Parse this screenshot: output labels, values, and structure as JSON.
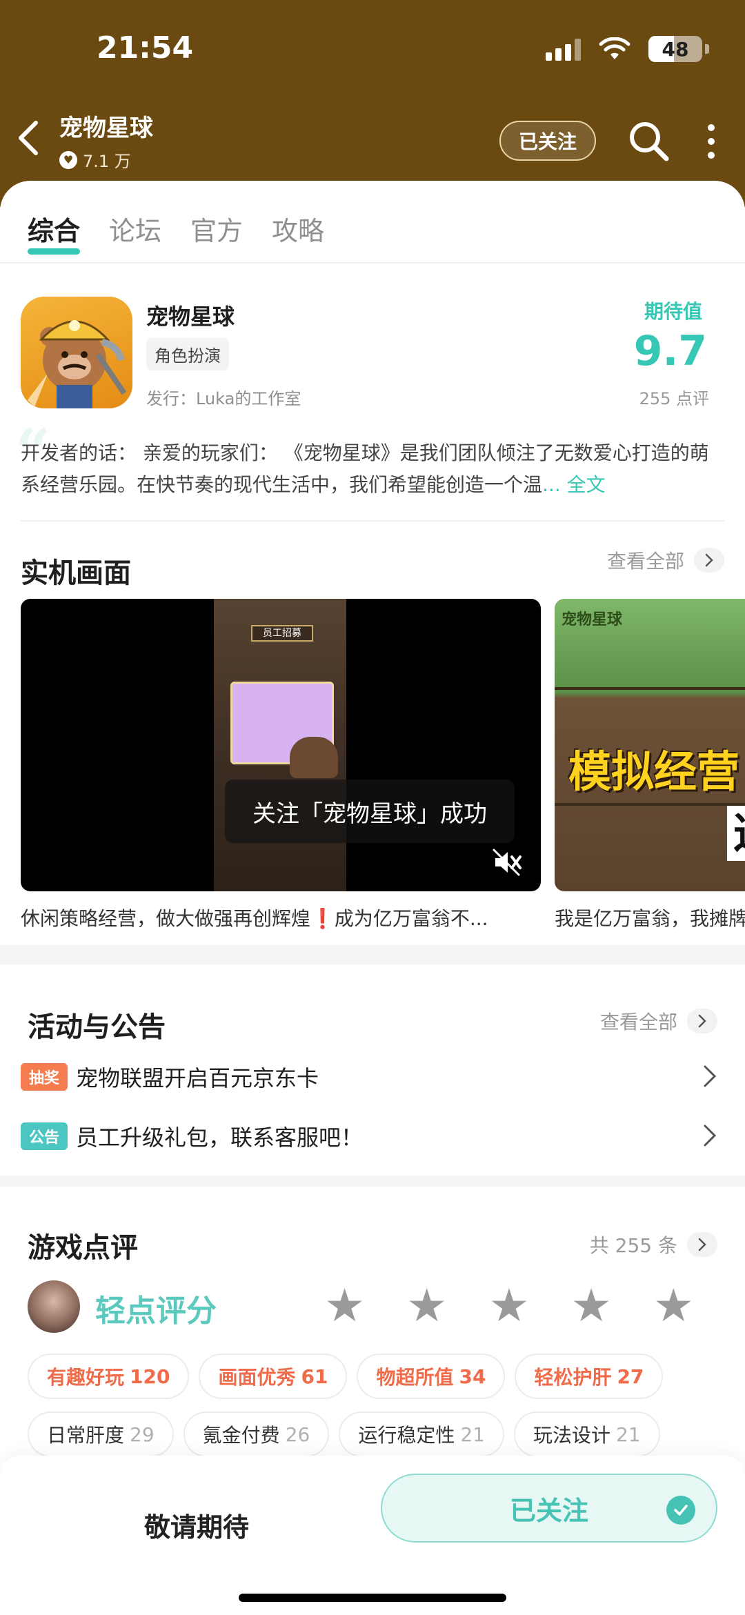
{
  "status_bar": {
    "time": "21:54",
    "battery": "48"
  },
  "header": {
    "title": "宠物星球",
    "followers": "7.1 万",
    "follow_button": "已关注"
  },
  "tabs": [
    {
      "label": "综合",
      "active": true
    },
    {
      "label": "论坛",
      "active": false
    },
    {
      "label": "官方",
      "active": false
    },
    {
      "label": "攻略",
      "active": false
    }
  ],
  "game": {
    "name": "宠物星球",
    "genre": "角色扮演",
    "publisher": "发行：Luka的工作室",
    "expect_label": "期待值",
    "expect_score": "9.7",
    "review_count": "255 点评"
  },
  "developer_note": {
    "text": "开发者的话：    亲爱的玩家们：    《宠物星球》是我们团队倾注了无数爱心打造的萌系经营乐园。在快节奏的现代生活中，我们希望能创造一个温",
    "read_more": "... 全文"
  },
  "screenshots": {
    "title": "实机画面",
    "see_all": "查看全部",
    "items": [
      {
        "caption": "休闲策略经营，做大做强再创辉煌❗️成为亿万富翁不...",
        "toast": "关注「宠物星球」成功",
        "sign": "员工招募"
      },
      {
        "caption": "我是亿万富翁，我摊牌了",
        "logo": "宠物星球",
        "banner": "模拟经营",
        "overflow_char": "这"
      }
    ]
  },
  "announcements": {
    "title": "活动与公告",
    "see_all": "查看全部",
    "items": [
      {
        "badge": "抽奖",
        "text": "宠物联盟开启百元京东卡"
      },
      {
        "badge": "公告",
        "text": "员工升级礼包，联系客服吧！"
      }
    ]
  },
  "reviews": {
    "title": "游戏点评",
    "total": "共 255 条",
    "rate_label": "轻点评分",
    "hot_tags": [
      {
        "label": "有趣好玩",
        "count": "120"
      },
      {
        "label": "画面优秀",
        "count": "61"
      },
      {
        "label": "物超所值",
        "count": "34"
      },
      {
        "label": "轻松护肝",
        "count": "27"
      }
    ],
    "tags": [
      {
        "label": "日常肝度",
        "count": "29"
      },
      {
        "label": "氪金付费",
        "count": "26"
      },
      {
        "label": "运行稳定性",
        "count": "21"
      },
      {
        "label": "玩法设计",
        "count": "21"
      }
    ]
  },
  "bottom_bar": {
    "stay_tuned": "敬请期待",
    "followed": "已关注"
  },
  "colors": {
    "header_bg": "#6b4a12",
    "accent": "#36c7b5",
    "hot_tag": "#f06b4a"
  }
}
